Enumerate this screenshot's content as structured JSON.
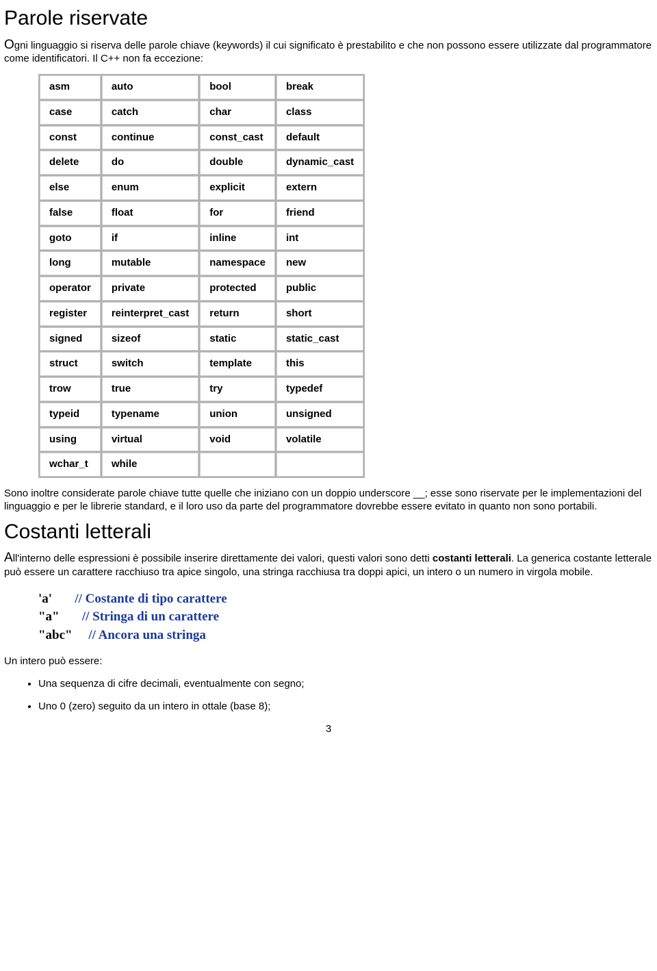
{
  "h1a": "Parole riservate",
  "intro1_drop": "O",
  "intro1_rest": "gni linguaggio si riserva delle parole chiave (keywords) il cui significato è prestabilito e che non possono essere utilizzate dal programmatore come identificatori. Il C++ non fa eccezione:",
  "keywords": [
    [
      "asm",
      "auto",
      "bool",
      "break"
    ],
    [
      "case",
      "catch",
      "char",
      "class"
    ],
    [
      "const",
      "continue",
      "const_cast",
      "default"
    ],
    [
      "delete",
      "do",
      "double",
      "dynamic_cast"
    ],
    [
      "else",
      "enum",
      "explicit",
      "extern"
    ],
    [
      "false",
      "float",
      "for",
      "friend"
    ],
    [
      "goto",
      "if",
      "inline",
      "int"
    ],
    [
      "long",
      "mutable",
      "namespace",
      "new"
    ],
    [
      "operator",
      "private",
      "protected",
      "public"
    ],
    [
      "register",
      "reinterpret_cast",
      "return",
      "short"
    ],
    [
      "signed",
      "sizeof",
      "static",
      "static_cast"
    ],
    [
      "struct",
      "switch",
      "template",
      "this"
    ],
    [
      "trow",
      "true",
      "try",
      "typedef"
    ],
    [
      "typeid",
      "typename",
      "union",
      "unsigned"
    ],
    [
      "using",
      "virtual",
      "void",
      "volatile"
    ],
    [
      "wchar_t",
      "while",
      "",
      ""
    ]
  ],
  "para_underscore": "Sono inoltre considerate parole chiave tutte quelle che iniziano con un doppio underscore __; esse sono riservate per le implementazioni del linguaggio e per le librerie standard, e il loro uso da parte del programmatore dovrebbe essere evitato in quanto non sono portabili.",
  "h1b": "Costanti letterali",
  "intro2_drop": "A",
  "intro2_rest_a": "ll'interno delle espressioni è possibile inserire direttamente dei valori, questi valori sono detti ",
  "intro2_bold": "costanti letterali",
  "intro2_rest_b": ". La generica costante letterale può essere un carattere racchiuso tra apice singolo, una stringa racchiusa tra doppi apici, un intero o un numero in virgola mobile.",
  "code": [
    {
      "s": "'a'       ",
      "c": "// Costante di tipo carattere"
    },
    {
      "s": "\"a\"       ",
      "c": "// Stringa di un carattere"
    },
    {
      "s": "\"abc\"     ",
      "c": "// Ancora una stringa"
    }
  ],
  "para_intero": "Un intero può essere:",
  "bullets": [
    "Una sequenza di cifre decimali, eventualmente con segno;",
    "Uno 0 (zero) seguito da un intero in ottale (base 8);"
  ],
  "page": "3"
}
